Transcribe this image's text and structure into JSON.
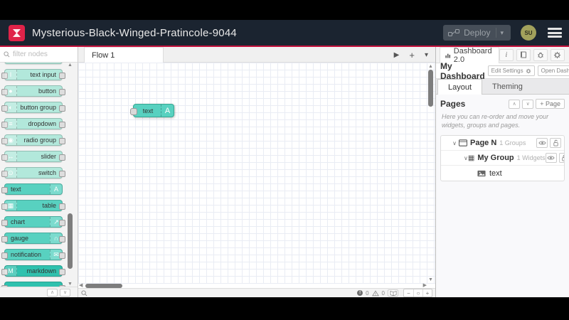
{
  "header": {
    "title": "Mysterious-Black-Winged-Pratincole-9044",
    "deploy_label": "Deploy",
    "avatar_initials": "SU"
  },
  "palette": {
    "filter_placeholder": "filter nodes",
    "nodes": [
      {
        "id": "partial-top",
        "label": "",
        "glyph": "",
        "icon_side": "none",
        "shade": "light",
        "ports": "both"
      },
      {
        "id": "text-input",
        "label": "text input",
        "glyph": "I",
        "icon_side": "left",
        "shade": "light",
        "ports": "both"
      },
      {
        "id": "button",
        "label": "button",
        "glyph": "●",
        "icon_side": "left",
        "shade": "light",
        "ports": "both"
      },
      {
        "id": "button-group",
        "label": "button group",
        "glyph": "◐",
        "icon_side": "left",
        "shade": "light",
        "ports": "both"
      },
      {
        "id": "dropdown",
        "label": "dropdown",
        "glyph": "≡",
        "icon_side": "left",
        "shade": "light",
        "ports": "both"
      },
      {
        "id": "radio-group",
        "label": "radio group",
        "glyph": "◉",
        "icon_side": "left",
        "shade": "light",
        "ports": "both"
      },
      {
        "id": "slider",
        "label": "slider",
        "glyph": "↔",
        "icon_side": "left",
        "shade": "light",
        "ports": "both"
      },
      {
        "id": "switch",
        "label": "switch",
        "glyph": "⊙",
        "icon_side": "left",
        "shade": "light",
        "ports": "both"
      },
      {
        "id": "text",
        "label": "text",
        "glyph": "A",
        "icon_side": "right",
        "shade": "mid",
        "ports": "left"
      },
      {
        "id": "table",
        "label": "table",
        "glyph": "▦",
        "icon_side": "left",
        "shade": "mid",
        "ports": "both"
      },
      {
        "id": "chart",
        "label": "chart",
        "glyph": "↗",
        "icon_side": "right",
        "shade": "mid",
        "ports": "both"
      },
      {
        "id": "gauge",
        "label": "gauge",
        "glyph": "∩",
        "icon_side": "right",
        "shade": "mid",
        "ports": "both"
      },
      {
        "id": "notification",
        "label": "notification",
        "glyph": "✉",
        "icon_side": "right",
        "shade": "mid",
        "ports": "both"
      },
      {
        "id": "markdown",
        "label": "markdown",
        "glyph": "M",
        "icon_side": "left",
        "shade": "dark",
        "ports": "both"
      },
      {
        "id": "partial-bottom",
        "label": "",
        "glyph": "",
        "icon_side": "none",
        "shade": "dark",
        "ports": "both"
      }
    ]
  },
  "workspace": {
    "tab_label": "Flow 1",
    "canvas_node": {
      "label": "text",
      "glyph": "A"
    },
    "footer": {
      "error_count": "0",
      "warning_count": "0"
    }
  },
  "sidebar": {
    "tab_label": "Dashboard 2.0",
    "dashboard_title": "My Dashboard",
    "edit_settings_label": "Edit Settings",
    "open_dashboard_label": "Open Dashboard",
    "tab_layout": "Layout",
    "tab_theming": "Theming",
    "pages_heading": "Pages",
    "add_page_label": "+ Page",
    "help_text": "Here you can re-order and move your widgets, groups and pages.",
    "tree": {
      "page_name": "Page N",
      "page_meta": "1 Groups",
      "group_name": "My Group",
      "group_meta": "1 Widgets",
      "widget_name": "text"
    }
  },
  "colors": {
    "header_bg": "#1b2430",
    "accent_red": "#c4113c",
    "logo_red": "#e02349",
    "node_teal_light": "#b2e8db",
    "node_teal_mid": "#58d1c0",
    "node_teal_dark": "#2fc1ae",
    "avatar_olive": "#a2a15c"
  }
}
